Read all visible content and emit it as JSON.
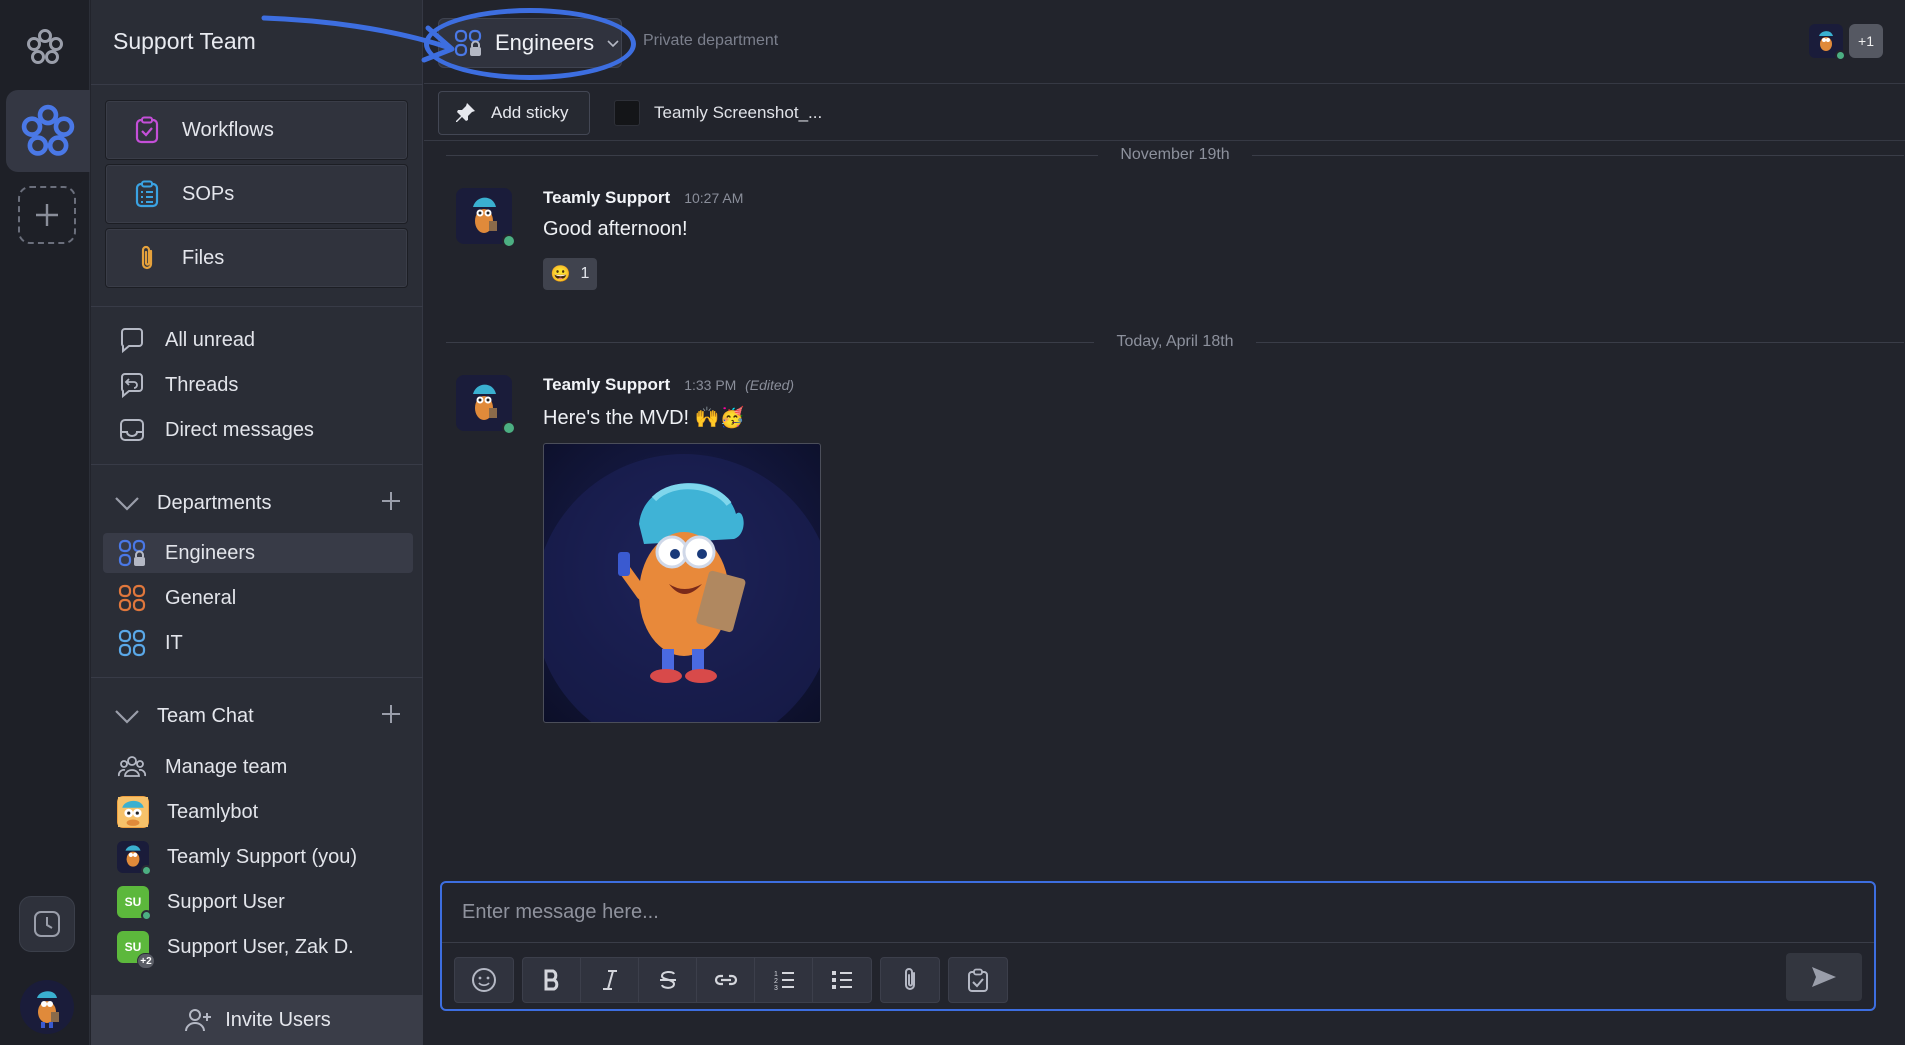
{
  "rail": {
    "logo_icon": "flower-logo-icon",
    "workspace_icon": "workspace-flower-icon",
    "add_workspace_icon": "plus-icon",
    "history_icon": "clock-icon"
  },
  "sidebar": {
    "team_title": "Support Team",
    "tools": [
      {
        "label": "Workflows",
        "icon": "workflow-clipboard-icon",
        "color": "#c44fd8"
      },
      {
        "label": "SOPs",
        "icon": "sop-list-icon",
        "color": "#3aa3e3"
      },
      {
        "label": "Files",
        "icon": "paperclip-icon",
        "color": "#e6a23c"
      }
    ],
    "nav": [
      {
        "label": "All unread",
        "icon": "chat-bubble-icon"
      },
      {
        "label": "Threads",
        "icon": "threads-icon"
      },
      {
        "label": "Direct messages",
        "icon": "inbox-icon"
      }
    ],
    "departments": {
      "title": "Departments",
      "items": [
        {
          "label": "Engineers",
          "icon": "private-group-icon",
          "color": "#4a78e6",
          "active": true
        },
        {
          "label": "General",
          "icon": "group-icon",
          "color": "#e0773c"
        },
        {
          "label": "IT",
          "icon": "group-icon",
          "color": "#5aa8e8"
        }
      ]
    },
    "team_chat": {
      "title": "Team Chat",
      "items": [
        {
          "label": "Manage team",
          "icon": "people-icon"
        },
        {
          "label": "Teamlybot",
          "icon": "teamlybot-avatar"
        },
        {
          "label": "Teamly Support (you)",
          "icon": "teamly-support-avatar"
        },
        {
          "label": "Support User",
          "initials": "SU"
        },
        {
          "label": "Support User, Zak D.",
          "initials": "SU",
          "extra": "+2"
        }
      ]
    },
    "invite_label": "Invite Users"
  },
  "header": {
    "channel_name": "Engineers",
    "channel_subtitle": "Private department",
    "members_more": "+1"
  },
  "stickybar": {
    "add_sticky_label": "Add sticky",
    "file_name": "Teamly Screenshot_..."
  },
  "messages": {
    "day1": "November 19th",
    "msg1": {
      "author": "Teamly Support",
      "time": "10:27 AM",
      "text": "Good afternoon!",
      "reaction_emoji": "😀",
      "reaction_count": "1"
    },
    "day2": "Today, April 18th",
    "msg2": {
      "author": "Teamly Support",
      "time": "1:33 PM",
      "edited": "(Edited)",
      "text": "Here's the MVD! 🙌🥳"
    }
  },
  "composer": {
    "placeholder": "Enter message here..."
  },
  "colors": {
    "accent": "#3d6ee0",
    "online": "#4caf82",
    "su_avatar": "#5cb83c"
  }
}
